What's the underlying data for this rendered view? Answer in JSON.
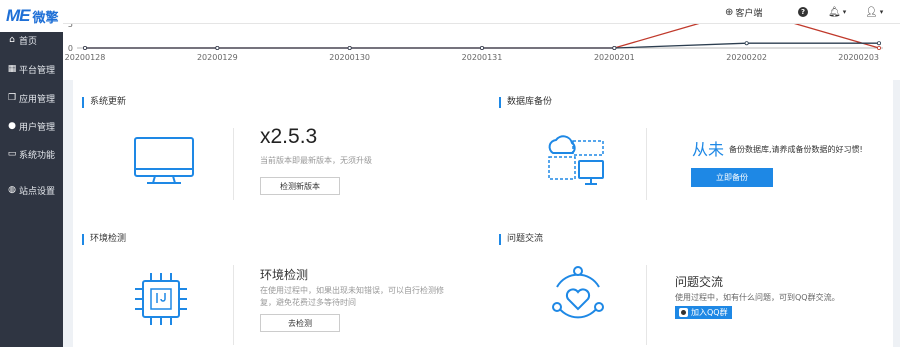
{
  "app": {
    "logo_mark": "ME",
    "logo_text": "微擎"
  },
  "sidebar": {
    "items": [
      {
        "label": "首页",
        "icon": "home-icon"
      },
      {
        "label": "平台管理",
        "icon": "grid-icon"
      },
      {
        "label": "应用管理",
        "icon": "cube-icon"
      },
      {
        "label": "用户管理",
        "icon": "user-icon"
      },
      {
        "label": "系统功能",
        "icon": "monitor-icon"
      },
      {
        "label": "站点设置",
        "icon": "globe-icon"
      }
    ]
  },
  "topbar": {
    "client_label": "客户端",
    "help_icon": "question-icon",
    "bell_icon": "bell-icon",
    "user_icon": "user-icon"
  },
  "chart_data": {
    "type": "line",
    "categories": [
      "20200128",
      "20200129",
      "20200130",
      "20200131",
      "20200201",
      "20200202",
      "20200203"
    ],
    "series": [
      {
        "color": "#c0392b",
        "values": [
          0,
          0,
          0,
          0,
          0,
          8,
          0
        ]
      },
      {
        "color": "#2c3e50",
        "values": [
          0,
          0,
          0,
          0,
          0,
          1,
          1
        ]
      }
    ],
    "ytick_labels": [
      "5",
      "0"
    ],
    "ylim": [
      0,
      5
    ]
  },
  "system_update": {
    "title": "系统更新",
    "version": "x2.5.3",
    "status": "当前版本即最新版本，无须升级",
    "button": "检测新版本"
  },
  "db_backup": {
    "title": "数据库备份",
    "highlight": "从未",
    "tip": "备份数据库,请养成备份数据的好习惯!",
    "button": "立即备份"
  },
  "env_check": {
    "title": "环境检测",
    "heading": "环境检测",
    "desc": "在使用过程中，如果出现未知错误，可以自行检测修复，避免花费过多等待时间",
    "button": "去检测"
  },
  "qa": {
    "title": "问题交流",
    "heading": "问题交流",
    "desc": "使用过程中，如有什么问题，可到QQ群交流。",
    "button": "加入QQ群"
  },
  "colors": {
    "accent": "#1e88e5",
    "sidebar_bg": "#2f3542"
  }
}
